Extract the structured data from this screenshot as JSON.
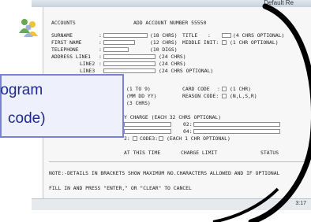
{
  "window": {
    "title": "Default Re"
  },
  "statusbar": {
    "clock": "3:17"
  },
  "form": {
    "title": "ACCOUNTS",
    "header": "ADD ACCOUNT NUMBER 55550",
    "rows": {
      "surname": {
        "label": "SURNAME",
        "colon": ":",
        "hint": "(18 CHRS)"
      },
      "title": {
        "label": "TITLE",
        "colon": ":",
        "hint": "(4 CHRS OPTIONAL)"
      },
      "first_name": {
        "label": "FIRST NAME",
        "colon": ":",
        "hint": "(12 CHRS)"
      },
      "middle_init": {
        "label": "MIDDLE INIT:",
        "hint": "(1 CHR OPTIONAL)"
      },
      "telephone": {
        "label": "TELEPHONE",
        "colon": ":",
        "hint": "(10 DIGS)"
      },
      "address1": {
        "label": "ADDRESS LINE1",
        "colon": ":",
        "hint": "(24 CHRS)"
      },
      "address2": {
        "label": "LINE2",
        "colon": ":",
        "hint": "(24 CHRS)"
      },
      "address3": {
        "label": "LINE3",
        "hint": "(24 CHRS OPTIONAL)"
      },
      "hint_1to9": "(1 TO 9)",
      "hint_date": "(MM DD YY)",
      "hint_3chrs": "(3 CHRS)",
      "card_code": {
        "label": "CARD CODE",
        "colon": ":",
        "hint": "(1 CHR)"
      },
      "reason_code": {
        "label": "REASON CODE:",
        "hint": "(N,L,S,R)"
      },
      "charge": {
        "label": "Y CHARGE (EACH 32 CHRS OPTIONAL)",
        "code02": "02:",
        "code04": "04:"
      },
      "codes": {
        "code2": "2:",
        "code3": "CODE3:",
        "hint": "(EACH 1 CHR OPTIONAL)"
      },
      "cols": {
        "c1": "AT THIS TIME",
        "c2": "CHARGE LIMIT",
        "c3": "STATUS"
      }
    },
    "note": "NOTE:-DETAILS IN BRACKETS SHOW MAXIMUM NO.CHARACTERS ALLOWED AND IF OPTIONAL",
    "instruction": "FILL IN AND PRESS \"ENTER,\" OR \"CLEAR\" TO CANCEL"
  },
  "overlay": {
    "line1": "rogram",
    "line2": "code)"
  },
  "colors": {
    "overlay_border": "#7b83d0",
    "overlay_text": "#1c2a8f",
    "arc": "#000000"
  },
  "icons": {
    "app": "users-icon"
  }
}
